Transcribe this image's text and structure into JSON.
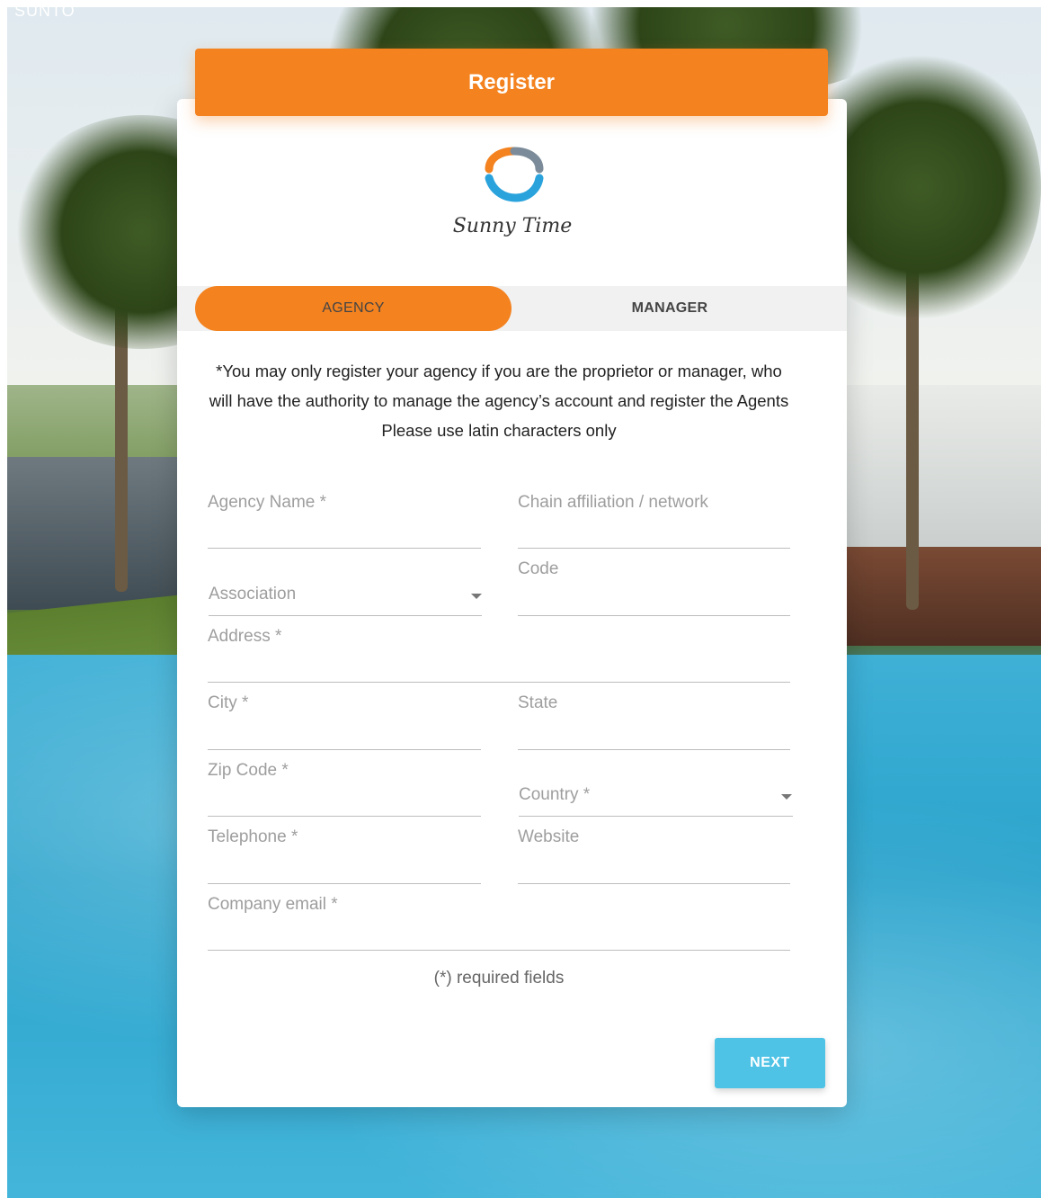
{
  "brand": {
    "corner_text": "SUNTO",
    "logo_text": "Sunny Time",
    "accent": "#f3821f",
    "cta": "#4ec3e6"
  },
  "header": {
    "title": "Register"
  },
  "tabs": [
    {
      "label": "AGENCY",
      "active": true
    },
    {
      "label": "MANAGER",
      "active": false
    }
  ],
  "notice": {
    "line1": "*You may only register your agency if you are the proprietor or manager, who will have the authority to manage the agency’s account and register the Agents",
    "line2": "Please use latin characters only"
  },
  "form": {
    "agency_name": "Agency Name *",
    "chain_affiliation": "Chain affiliation / network",
    "association": "Association",
    "code": "Code",
    "address": "Address *",
    "city": "City *",
    "state": "State",
    "zip_code": "Zip Code *",
    "country": "Country *",
    "telephone": "Telephone *",
    "website": "Website",
    "company_email": "Company email *"
  },
  "required_note": "(*) required fields",
  "actions": {
    "next_label": "NEXT"
  }
}
